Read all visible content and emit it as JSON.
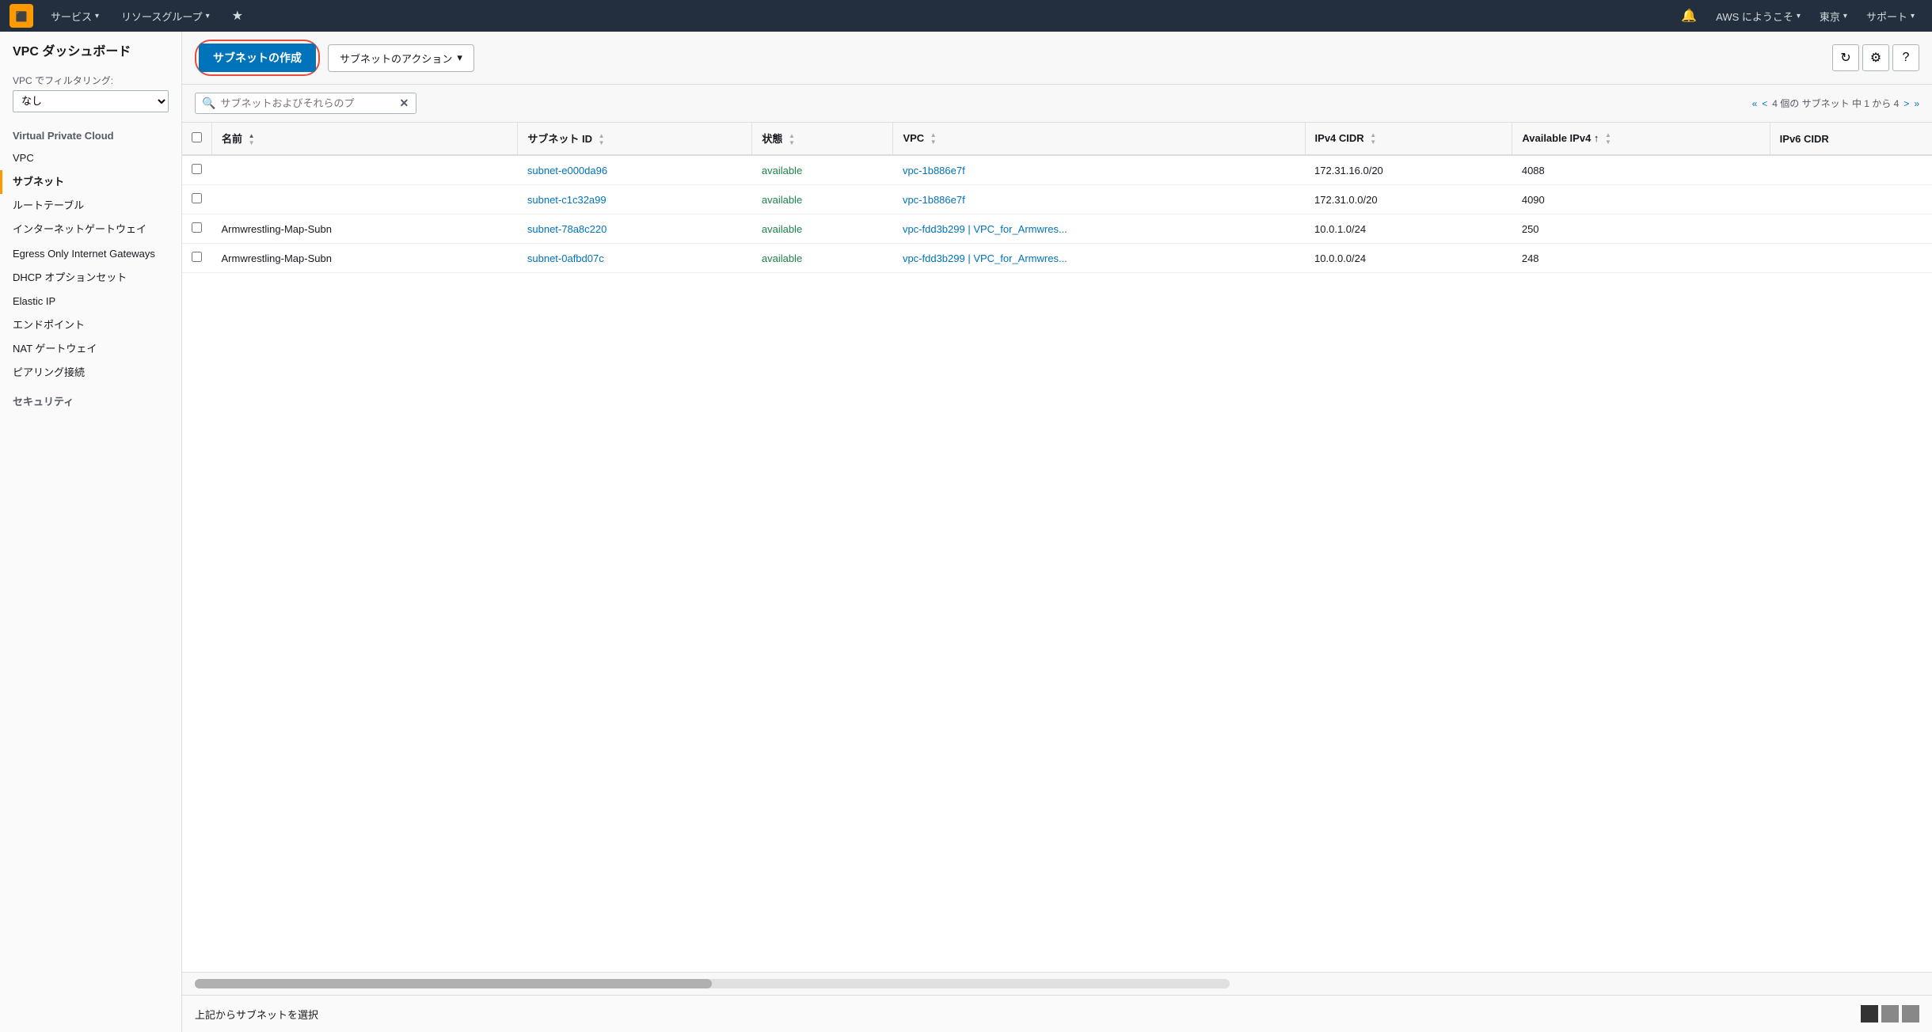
{
  "topnav": {
    "logo_alt": "AWS",
    "services_label": "サービス",
    "resourcegroups_label": "リソースグループ",
    "bell_icon": "🔔",
    "aws_welcome": "AWS にようこそ",
    "region": "東京",
    "support": "サポート"
  },
  "sidebar": {
    "dashboard_title": "VPC ダッシュボード",
    "filter_label": "VPC でフィルタリング:",
    "filter_value": "なし",
    "groups": [
      {
        "title": "Virtual Private Cloud",
        "items": [
          {
            "label": "VPC",
            "active": false
          },
          {
            "label": "サブネット",
            "active": true
          },
          {
            "label": "ルートテーブル",
            "active": false
          },
          {
            "label": "インターネットゲートウェイ",
            "active": false
          },
          {
            "label": "Egress Only Internet Gateways",
            "active": false
          },
          {
            "label": "DHCP オプションセット",
            "active": false
          },
          {
            "label": "Elastic IP",
            "active": false
          },
          {
            "label": "エンドポイント",
            "active": false
          },
          {
            "label": "NAT ゲートウェイ",
            "active": false
          },
          {
            "label": "ピアリング接続",
            "active": false
          }
        ]
      },
      {
        "title": "セキュリティ",
        "items": []
      }
    ]
  },
  "toolbar": {
    "create_button": "サブネットの作成",
    "action_button": "サブネットのアクション"
  },
  "search": {
    "placeholder": "サブネットおよびそれらのプ",
    "pagination": "4 個の サブネット 中 1 から 4"
  },
  "table": {
    "columns": [
      {
        "label": "名前",
        "sortable": true,
        "sorted": "asc"
      },
      {
        "label": "サブネット ID",
        "sortable": true
      },
      {
        "label": "状態",
        "sortable": true
      },
      {
        "label": "VPC",
        "sortable": true
      },
      {
        "label": "IPv4 CIDR",
        "sortable": true
      },
      {
        "label": "Available IPv4 ↑",
        "sortable": true
      },
      {
        "label": "IPv6 CIDR",
        "sortable": false
      }
    ],
    "rows": [
      {
        "name": "",
        "subnet_id": "subnet-e000da96",
        "state": "available",
        "vpc": "vpc-1b886e7f",
        "ipv4_cidr": "172.31.16.0/20",
        "available_ipv4": "4088",
        "ipv6_cidr": ""
      },
      {
        "name": "",
        "subnet_id": "subnet-c1c32a99",
        "state": "available",
        "vpc": "vpc-1b886e7f",
        "ipv4_cidr": "172.31.0.0/20",
        "available_ipv4": "4090",
        "ipv6_cidr": ""
      },
      {
        "name": "Armwrestling-Map-Subn",
        "subnet_id": "subnet-78a8c220",
        "state": "available",
        "vpc": "vpc-fdd3b299 | VPC_for_Armwres...",
        "ipv4_cidr": "10.0.1.0/24",
        "available_ipv4": "250",
        "ipv6_cidr": ""
      },
      {
        "name": "Armwrestling-Map-Subn",
        "subnet_id": "subnet-0afbd07c",
        "state": "available",
        "vpc": "vpc-fdd3b299 | VPC_for_Armwres...",
        "ipv4_cidr": "10.0.0.0/24",
        "available_ipv4": "248",
        "ipv6_cidr": ""
      }
    ]
  },
  "bottom_panel": {
    "select_prompt": "上記からサブネットを選択"
  }
}
